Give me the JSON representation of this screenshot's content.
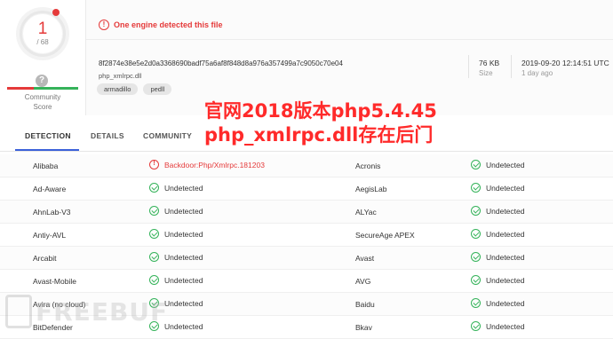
{
  "score": {
    "detections": "1",
    "total": "/ 68",
    "community_label": "Community\nScore",
    "question_mark": "?"
  },
  "header": {
    "alert_text": "One engine detected this file",
    "hash": "8f2874e38e5e2d0a3368690badf75a6af8f848d8a976a357499a7c9050c70e04",
    "filename": "php_xmlrpc.dll",
    "tags": [
      "armadillo",
      "pedll"
    ],
    "size_value": "76 KB",
    "size_label": "Size",
    "date_value": "2019-09-20 12:14:51 UTC",
    "date_label": "1 day ago"
  },
  "tabs": [
    "DETECTION",
    "DETAILS",
    "COMMUNITY"
  ],
  "overlay": {
    "line1": "官网2018版本php5.4.45",
    "line2": "php_xmlrpc.dll存在后门"
  },
  "detections": [
    {
      "left_engine": "Alibaba",
      "left_result": "Backdoor:Php/Xmlrpc.181203",
      "left_flagged": true,
      "right_engine": "Acronis",
      "right_result": "Undetected"
    },
    {
      "left_engine": "Ad-Aware",
      "left_result": "Undetected",
      "left_flagged": false,
      "right_engine": "AegisLab",
      "right_result": "Undetected"
    },
    {
      "left_engine": "AhnLab-V3",
      "left_result": "Undetected",
      "left_flagged": false,
      "right_engine": "ALYac",
      "right_result": "Undetected"
    },
    {
      "left_engine": "Antiy-AVL",
      "left_result": "Undetected",
      "left_flagged": false,
      "right_engine": "SecureAge APEX",
      "right_result": "Undetected"
    },
    {
      "left_engine": "Arcabit",
      "left_result": "Undetected",
      "left_flagged": false,
      "right_engine": "Avast",
      "right_result": "Undetected"
    },
    {
      "left_engine": "Avast-Mobile",
      "left_result": "Undetected",
      "left_flagged": false,
      "right_engine": "AVG",
      "right_result": "Undetected"
    },
    {
      "left_engine": "Avira (no cloud)",
      "left_result": "Undetected",
      "left_flagged": false,
      "right_engine": "Baidu",
      "right_result": "Undetected"
    },
    {
      "left_engine": "BitDefender",
      "left_result": "Undetected",
      "left_flagged": false,
      "right_engine": "Bkav",
      "right_result": "Undetected"
    }
  ],
  "watermark": "FREEBUF",
  "colors": {
    "alert": "#e53a3a",
    "ok": "#35b35a",
    "tab_accent": "#3b61d9",
    "overlay": "#ff2a2a"
  }
}
